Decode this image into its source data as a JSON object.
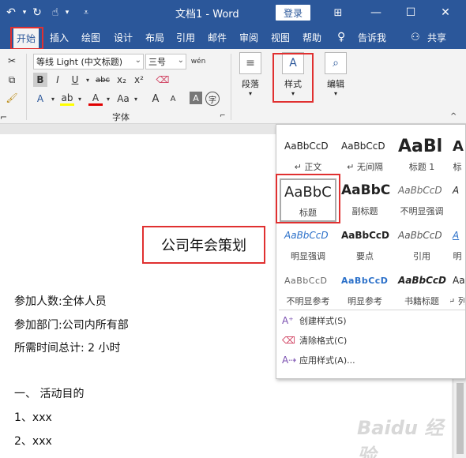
{
  "titlebar": {
    "undo_icon": "undo-icon",
    "redo_icon": "redo-icon",
    "touch_icon": "touch-mode-icon",
    "more_icon": "customize-icon",
    "doc_title": "文档1 - Word",
    "login_label": "登录",
    "restore_icon": "ribbon-display-icon",
    "minimize_icon": "minimize-icon",
    "maximize_icon": "maximize-icon",
    "close_icon": "close-icon"
  },
  "menu": {
    "items": [
      "开始",
      "插入",
      "绘图",
      "设计",
      "布局",
      "引用",
      "邮件",
      "审阅",
      "视图",
      "帮助"
    ],
    "active": "开始",
    "tell_me": "告诉我",
    "share": "共享"
  },
  "ribbon": {
    "font_name": "等线 Light (中文标题)",
    "font_size": "三号",
    "phonetic": "wén",
    "bold": "B",
    "italic": "I",
    "underline": "U",
    "strike": "abc",
    "subscript": "x₂",
    "superscript": "x²",
    "text_effects": "A",
    "highlight": "ab",
    "font_color": "A",
    "case": "Aa",
    "grow": "A",
    "shrink": "A",
    "char_border": "A",
    "enclose": "字",
    "font_group_label": "字体",
    "paragraph_label": "段落",
    "styles_label": "样式",
    "editing_label": "编辑"
  },
  "styles_panel": {
    "cells": [
      {
        "sample": "AaBbCcD",
        "name": "↵ 正文"
      },
      {
        "sample": "AaBbCcD",
        "name": "↵ 无间隔"
      },
      {
        "sample": "AaBl",
        "name": "标题 1"
      },
      {
        "sample": "A",
        "name": "标"
      },
      {
        "sample": "AaBbC",
        "name": "标题"
      },
      {
        "sample": "AaBbC",
        "name": "副标题"
      },
      {
        "sample": "AaBbCcD",
        "name": "不明显强调"
      },
      {
        "sample": "A",
        "name": ""
      },
      {
        "sample": "AaBbCcD",
        "name": "明显强调"
      },
      {
        "sample": "AaBbCcD",
        "name": "要点"
      },
      {
        "sample": "AaBbCcD",
        "name": "引用"
      },
      {
        "sample": "A",
        "name": "明"
      },
      {
        "sample": "AaBbCcD",
        "name": "不明显参考"
      },
      {
        "sample": "AaBbCcD",
        "name": "明显参考"
      },
      {
        "sample": "AaBbCcD",
        "name": "书籍标题"
      },
      {
        "sample": "Aa",
        "name": "↵ 列"
      }
    ],
    "actions": [
      "创建样式(S)",
      "清除格式(C)",
      "应用样式(A)..."
    ]
  },
  "document": {
    "title": "公司年会策划",
    "lines": [
      "参加人数:全体人员",
      "参加部门:公司内所有部",
      "所需时间总计: 2 小时",
      "",
      "一、 活动目的",
      "1、xxx",
      "2、xxx"
    ]
  },
  "watermark": "Baidu 经验",
  "colors": {
    "brand": "#2b579a",
    "highlight_red": "#e03030"
  }
}
